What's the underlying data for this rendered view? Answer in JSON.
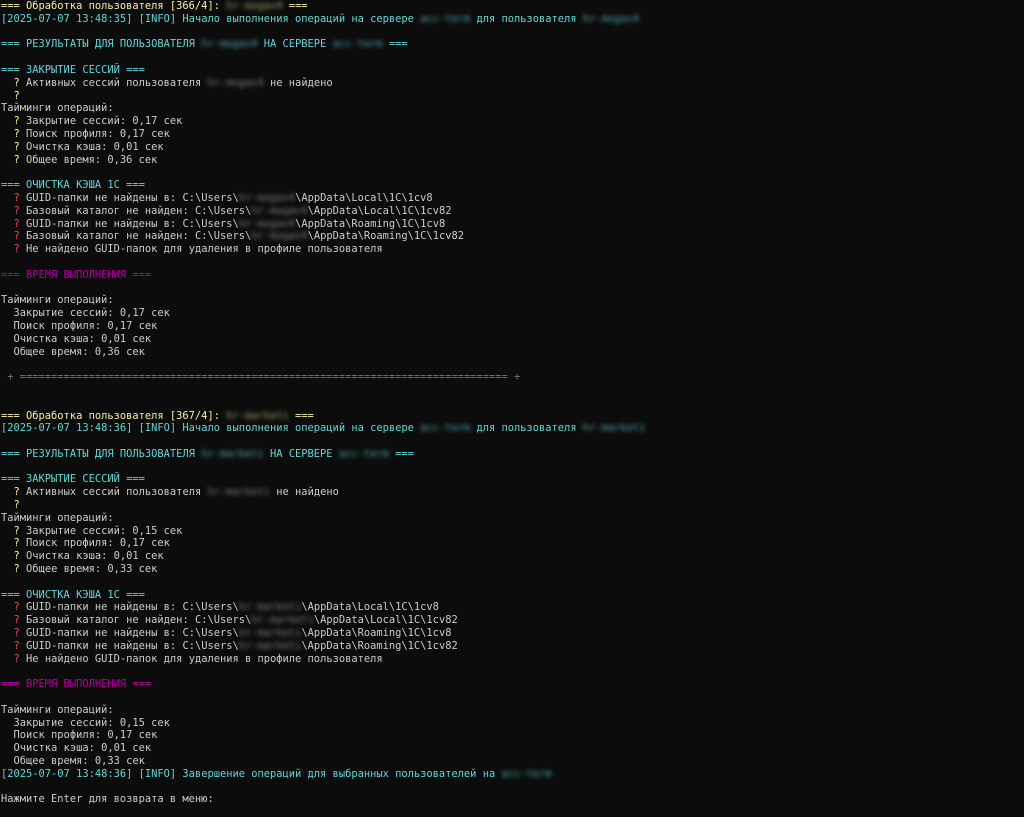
{
  "user1": {
    "header": "=== Обработка пользователя [366/4]: ",
    "name": "hr-mogav4",
    "header_end": " ===",
    "timestamp": "[2025-07-07 13:48:35]",
    "info_text": " [INFO] Начало выполнения операций на сервере ",
    "server": "acc-term",
    "info_mid": " для пользователя ",
    "results_prefix": "=== РЕЗУЛЬТАТЫ ДЛЯ ПОЛЬЗОВАТЕЛЯ ",
    "results_mid": " НА СЕРВЕРЕ ",
    "results_end": " ===",
    "sessions_header": "=== ЗАКРЫТИЕ СЕССИЙ ===",
    "sessions_msg_pre": "Активных сессий пользователя ",
    "sessions_msg_post": " не найдено",
    "timings_title": "Тайминги операций:",
    "t_close": "Закрытие сессий: 0,17 сек",
    "t_profile": "Поиск профиля: 0,17 сек",
    "t_cache": "Очистка кэша: 0,01 сек",
    "t_total": "Общее время: 0,36 сек",
    "cache_header": "=== ОЧИСТКА КЭША 1С ===",
    "c1_pre": "GUID-папки не найдены в: C:\\Users\\",
    "c1_post": "\\AppData\\Local\\1C\\1cv8",
    "c2_pre": "Базовый каталог не найден: C:\\Users\\",
    "c2_post": "\\AppData\\Local\\1C\\1cv82",
    "c3_pre": "GUID-папки не найдены в: C:\\Users\\",
    "c3_post": "\\AppData\\Roaming\\1C\\1cv8",
    "c4_pre": "Базовый каталог не найден: C:\\Users\\",
    "c4_post": "\\AppData\\Roaming\\1C\\1cv82",
    "c5": "Не найдено GUID-папок для удаления в профиле пользователя",
    "time_header": "=== ВРЕМЯ ВЫПОЛНЕНИЯ ==="
  },
  "separator": "+ ============================================================================== +",
  "user2": {
    "header": "=== Обработка пользователя [367/4]: ",
    "name": "hr-marketi",
    "header_end": " ===",
    "timestamp": "[2025-07-07 13:48:36]",
    "info_text": " [INFO] Начало выполнения операций на сервере ",
    "server": "acc-term",
    "info_mid": " для пользователя ",
    "results_prefix": "=== РЕЗУЛЬТАТЫ ДЛЯ ПОЛЬЗОВАТЕЛЯ ",
    "results_mid": " НА СЕРВЕРЕ ",
    "results_end": " ===",
    "sessions_header": "=== ЗАКРЫТИЕ СЕССИЙ ===",
    "sessions_msg_pre": "Активных сессий пользователя ",
    "sessions_msg_post": " не найдено",
    "timings_title": "Тайминги операций:",
    "t_close": "Закрытие сессий: 0,15 сек",
    "t_profile": "Поиск профиля: 0,17 сек",
    "t_cache": "Очистка кэша: 0,01 сек",
    "t_total": "Общее время: 0,33 сек",
    "cache_header": "=== ОЧИСТКА КЭША 1С ===",
    "c1_pre": "GUID-папки не найдены в: C:\\Users\\",
    "c1_post": "\\AppData\\Local\\1C\\1cv8",
    "c2_pre": "Базовый каталог не найден: C:\\Users\\",
    "c2_post": "\\AppData\\Local\\1C\\1cv82",
    "c3_pre": "GUID-папки не найдены в: C:\\Users\\",
    "c3_post": "\\AppData\\Roaming\\1C\\1cv8",
    "c4_pre": "GUID-папки не найдены в: C:\\Users\\",
    "c4_post": "\\AppData\\Roaming\\1C\\1cv82",
    "c5": "Не найдено GUID-папок для удаления в профиле пользователя",
    "time_header": "=== ВРЕМЯ ВЫПОЛНЕНИЯ ==="
  },
  "footer": {
    "timestamp": "[2025-07-07 13:48:36]",
    "text": " [INFO] Завершение операций для выбранных пользователей на ",
    "server": "acc-term",
    "prompt": "Нажмите Enter для возврата в меню:"
  },
  "glyph_yellow": "?",
  "glyph_red": "?",
  "colors": {
    "background": "#0c0c0c",
    "yellow": "#f9f1a5",
    "cyan": "#61d6d6",
    "magenta": "#b4009e",
    "red": "#e74856",
    "gray": "#cccccc"
  }
}
